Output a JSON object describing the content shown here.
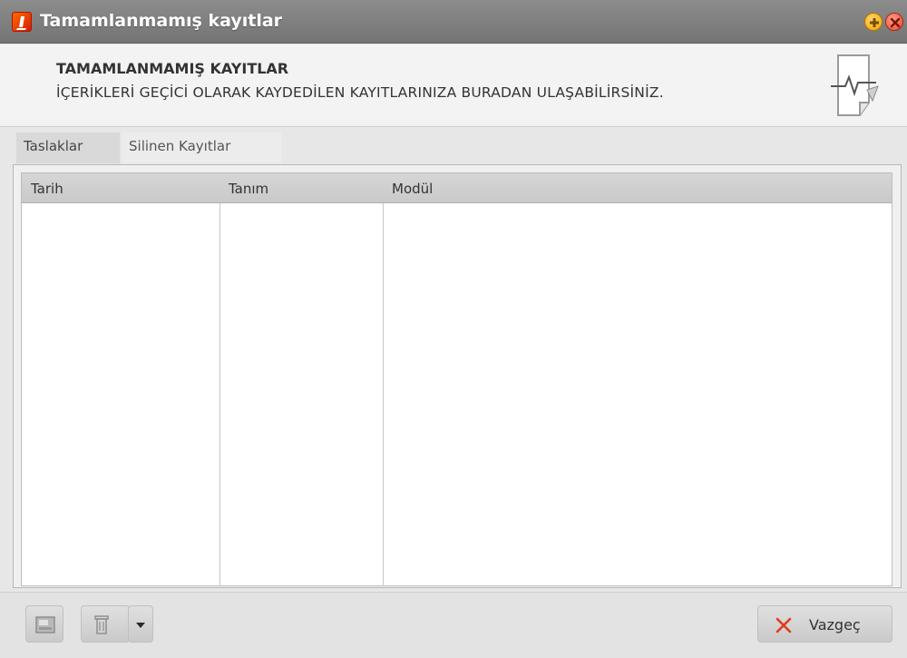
{
  "window": {
    "title": "Tamamlanmamış kayıtlar"
  },
  "header": {
    "title": "TAMAMLANMAMIŞ KAYITLAR",
    "subtitle": "İÇERİKLERİ GEÇİCİ OLARAK KAYDEDİLEN KAYITLARINIZA BURADAN ULAŞABİLİRSİNİZ."
  },
  "tabs": [
    {
      "label": "Taslaklar",
      "active": true
    },
    {
      "label": "Silinen Kayıtlar",
      "active": false
    }
  ],
  "grid": {
    "columns": [
      "Tarih",
      "Tanım",
      "Modül"
    ],
    "rows": []
  },
  "toolbar": {
    "cancel_label": "Vazgeç"
  },
  "icons": {
    "app": "logo-icon",
    "add": "add-circle-icon",
    "close": "close-circle-icon",
    "header": "document-chart-icon",
    "open": "open-folder-icon",
    "delete": "trash-icon",
    "dropdown": "caret-down-icon",
    "cancel": "x-icon"
  },
  "colors": {
    "titlebar": "#808080",
    "close_x": "#e03a1f",
    "accent_orange": "#ff6a00"
  }
}
